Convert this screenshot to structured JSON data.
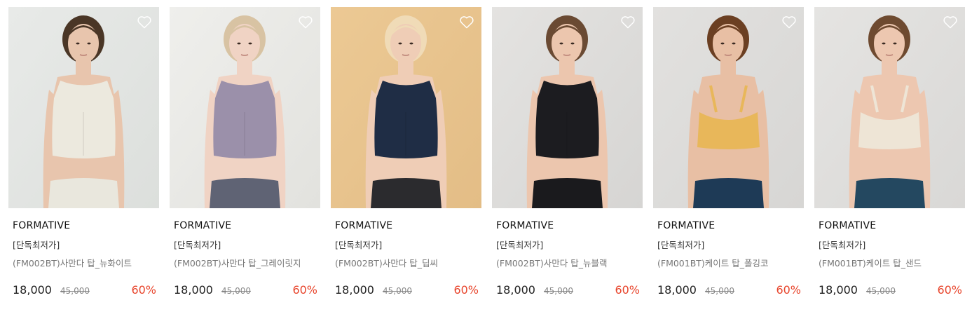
{
  "products": [
    {
      "brand": "FORMATIVE",
      "tag": "[단독최저가]",
      "name": "(FM002BT)사만다 탑_뉴화이트",
      "price": "18,000",
      "original_price": "45,000",
      "discount": "60%",
      "icon": "heart-outline-icon",
      "colors": {
        "bg": "#dcdfdc",
        "bg2": "#e8eae8",
        "skin": "#e8c5ad",
        "hair": "#4a3626",
        "top": "#ece9de",
        "bottom": "#e9e7dd"
      }
    },
    {
      "brand": "FORMATIVE",
      "tag": "[단독최저가]",
      "name": "(FM002BT)사만다 탑_그레이릿지",
      "price": "18,000",
      "original_price": "45,000",
      "discount": "60%",
      "icon": "heart-outline-icon",
      "colors": {
        "bg": "#e2e2de",
        "bg2": "#efefec",
        "skin": "#f0d3c4",
        "hair": "#d8c3a3",
        "top": "#9b90aa",
        "bottom": "#5f6374"
      }
    },
    {
      "brand": "FORMATIVE",
      "tag": "[단독최저가]",
      "name": "(FM002BT)사만다 탑_딥씨",
      "price": "18,000",
      "original_price": "45,000",
      "discount": "60%",
      "icon": "heart-outline-icon",
      "colors": {
        "bg": "#e3bd86",
        "bg2": "#ecc994",
        "skin": "#efcdb6",
        "hair": "#f0dbb7",
        "top": "#1f2d45",
        "bottom": "#2b2b2e"
      }
    },
    {
      "brand": "FORMATIVE",
      "tag": "[단독최저가]",
      "name": "(FM002BT)사만다 탑_뉴블랙",
      "price": "18,000",
      "original_price": "45,000",
      "discount": "60%",
      "icon": "heart-outline-icon",
      "colors": {
        "bg": "#d6d5d3",
        "bg2": "#e4e3e1",
        "skin": "#ecc6ae",
        "hair": "#6a4a33",
        "top": "#1c1c20",
        "bottom": "#1a1a1d"
      }
    },
    {
      "brand": "FORMATIVE",
      "tag": "[단독최저가]",
      "name": "(FM001BT)케이트 탑_폴깅코",
      "price": "18,000",
      "original_price": "45,000",
      "discount": "60%",
      "icon": "heart-outline-icon",
      "colors": {
        "bg": "#d7d6d4",
        "bg2": "#e2e1df",
        "skin": "#e8bfa4",
        "hair": "#6b3f22",
        "top": "#e8b75a",
        "bottom": "#1e3a56"
      }
    },
    {
      "brand": "FORMATIVE",
      "tag": "[단독최저가]",
      "name": "(FM001BT)케이트 탑_샌드",
      "price": "18,000",
      "original_price": "45,000",
      "discount": "60%",
      "icon": "heart-outline-icon",
      "colors": {
        "bg": "#d9d8d6",
        "bg2": "#e5e4e2",
        "skin": "#edc7b0",
        "hair": "#6e4a30",
        "top": "#eee5d6",
        "bottom": "#244860"
      }
    }
  ]
}
